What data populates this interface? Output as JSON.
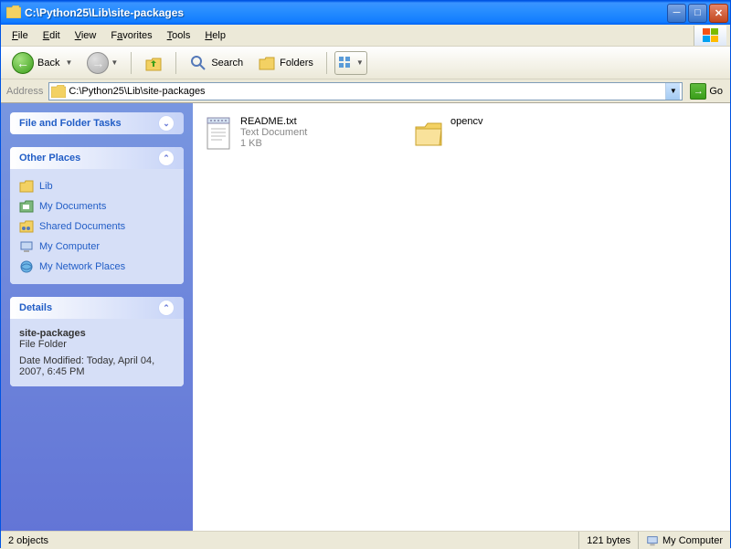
{
  "window": {
    "title": "C:\\Python25\\Lib\\site-packages"
  },
  "menubar": {
    "items": [
      {
        "u": "F",
        "rest": "ile"
      },
      {
        "u": "E",
        "rest": "dit"
      },
      {
        "u": "V",
        "rest": "iew"
      },
      {
        "u": "F",
        "pre": "",
        "rest": "avorites",
        "uidx": 1
      },
      {
        "u": "T",
        "rest": "ools"
      },
      {
        "u": "H",
        "rest": "elp"
      }
    ],
    "labels": [
      "File",
      "Edit",
      "View",
      "Favorites",
      "Tools",
      "Help"
    ]
  },
  "toolbar": {
    "back": "Back",
    "search": "Search",
    "folders": "Folders"
  },
  "addressbar": {
    "label": "Address",
    "path": "C:\\Python25\\Lib\\site-packages",
    "go": "Go"
  },
  "sidebar": {
    "tasks_title": "File and Folder Tasks",
    "places_title": "Other Places",
    "places": [
      {
        "label": "Lib",
        "icon": "folder"
      },
      {
        "label": "My Documents",
        "icon": "doc"
      },
      {
        "label": "Shared Documents",
        "icon": "shared"
      },
      {
        "label": "My Computer",
        "icon": "computer"
      },
      {
        "label": "My Network Places",
        "icon": "network"
      }
    ],
    "details_title": "Details",
    "details": {
      "name": "site-packages",
      "type": "File Folder",
      "modified": "Date Modified: Today, April 04, 2007, 6:45 PM"
    }
  },
  "files": [
    {
      "name": "README.txt",
      "type": "Text Document",
      "size": "1 KB",
      "kind": "text"
    },
    {
      "name": "opencv",
      "type": "",
      "size": "",
      "kind": "folder"
    }
  ],
  "statusbar": {
    "objects": "2 objects",
    "bytes": "121 bytes",
    "location": "My Computer"
  }
}
